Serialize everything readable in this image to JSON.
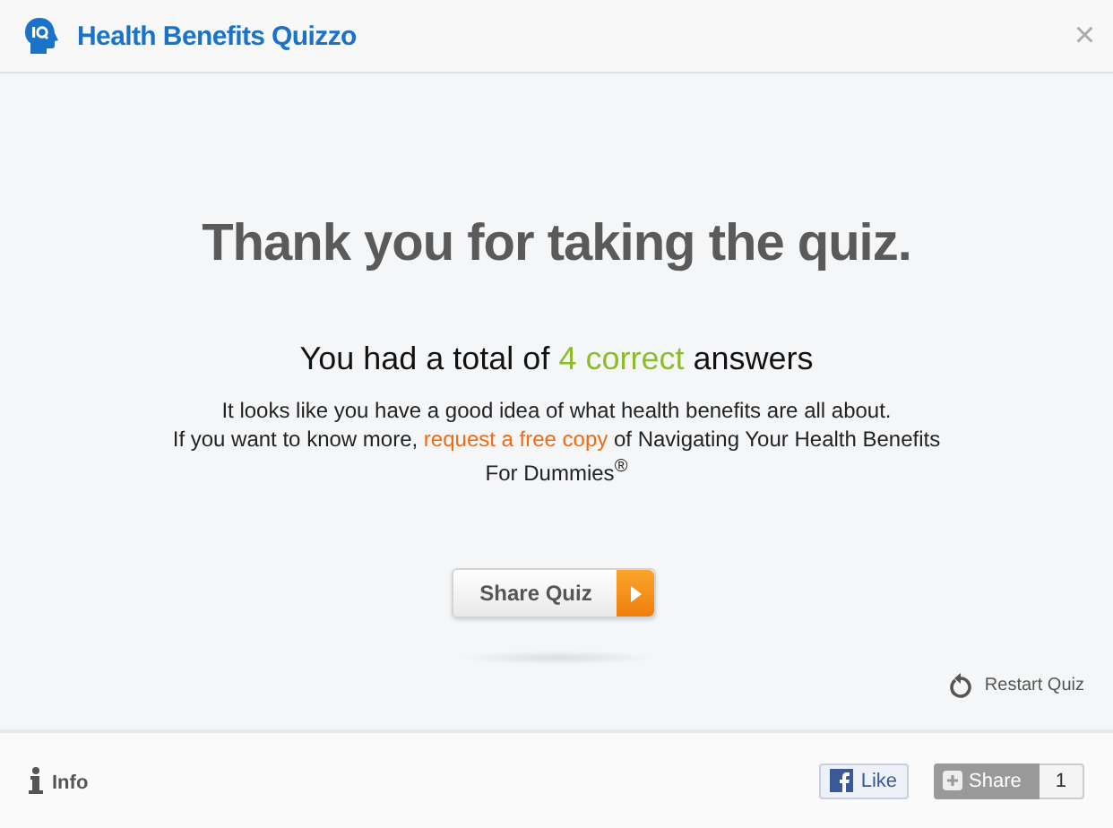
{
  "window": {
    "title": "Health Benefits Quizzo",
    "close": "×"
  },
  "heading": "Thank you for taking the quiz.",
  "score": {
    "before": "You had a total of ",
    "highlight": "4 correct",
    "after": " answers"
  },
  "message": {
    "before": "It looks like you have a good idea of what health benefits are all about.\nIf you want to know more, ",
    "link": "request a free copy",
    "after": " of Navigating Your Health Benefits\nFor Dummies$^{®}$"
  },
  "share_button": {
    "label": "Share Quiz"
  },
  "restart": {
    "label": "Restart Quiz"
  },
  "footer": {
    "info": "Info",
    "like": "Like",
    "share": "Share",
    "share_count": "1"
  }
}
